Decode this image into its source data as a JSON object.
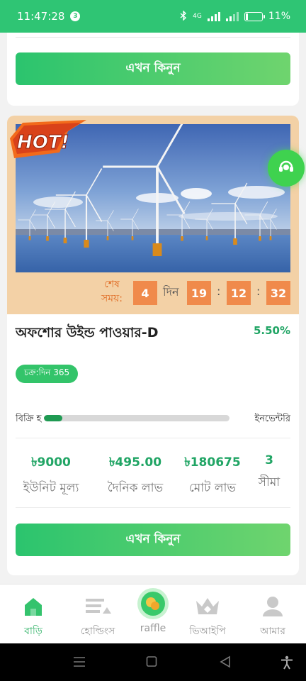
{
  "status_bar": {
    "time": "11:47:28",
    "notification_count": "3",
    "network": "4G",
    "battery": "11%"
  },
  "top_card": {
    "buy_label": "এখন কিনুন"
  },
  "product": {
    "badge": "HOT!",
    "countdown": {
      "label_line1": "শেষ",
      "label_line2": "সময়:",
      "days": "4",
      "days_unit": "দিন",
      "hours": "19",
      "minutes": "12",
      "seconds": "32"
    },
    "title": "অফশোর উইন্ড পাওয়ার-D",
    "rate": "5.50%",
    "cycle": "চক্র:দিন 365",
    "sold_label": "বিক্রি হ",
    "inventory_label": "ইনভেন্টরি",
    "sold_progress": 0.1,
    "stats": [
      {
        "value": "৳9000",
        "label": "ইউনিট মূল্য"
      },
      {
        "value": "৳495.00",
        "label": "দৈনিক লাভ"
      },
      {
        "value": "৳180675",
        "label": "মোট লাভ"
      },
      {
        "value": "3",
        "label": "সীমা"
      }
    ],
    "buy_label": "এখন কিনুন"
  },
  "bottom_nav": {
    "items": [
      {
        "label": "বাড়ি",
        "icon": "home-icon",
        "active": true
      },
      {
        "label": "হোল্ডিংস",
        "icon": "holdings-icon",
        "active": false
      },
      {
        "label": "raffle",
        "icon": "raffle-icon",
        "active": false
      },
      {
        "label": "ভিআইপি",
        "icon": "crown-icon",
        "active": false
      },
      {
        "label": "আমার",
        "icon": "user-icon",
        "active": false
      }
    ]
  },
  "colors": {
    "primary": "#2fc574",
    "accent_green": "#21a565",
    "timer_orange": "#f08a4b",
    "hero_bg": "#f3d1a6"
  }
}
